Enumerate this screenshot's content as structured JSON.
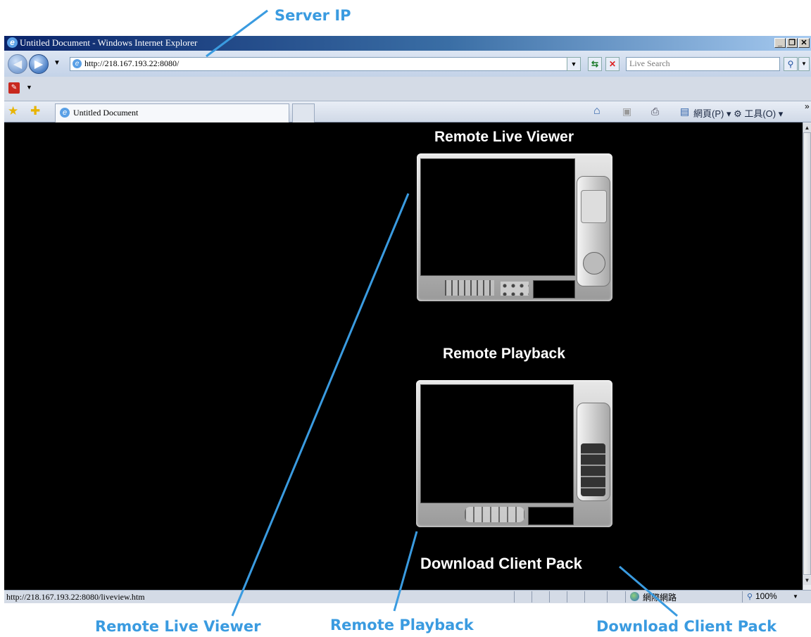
{
  "browser": {
    "window_title": "Untitled Document - Windows Internet Explorer",
    "address": "http://218.167.193.22:8080/",
    "search_placeholder": "Live Search",
    "tab_label": "Untitled Document",
    "toolbar_items": "網頁(P) ▾  ⚙ 工具(O) ▾",
    "status_url": "http://218.167.193.22:8080/liveview.htm",
    "zone": "網際網路",
    "zoom": "100%"
  },
  "page": {
    "live_viewer_title": "Remote Live Viewer",
    "playback_title": "Remote Playback",
    "download_title": "Download Client Pack"
  },
  "callouts": {
    "server_ip": "Server IP",
    "live_viewer": "Remote Live Viewer",
    "playback": "Remote Playback",
    "download": "Download Client Pack"
  },
  "colors": {
    "callout": "#3a9be0",
    "page_bg": "#000000",
    "title_bar": "#0a246a"
  },
  "icons": [
    "ie-logo-icon",
    "back-icon",
    "forward-icon",
    "page-icon",
    "refresh-icon",
    "stop-icon",
    "search-icon",
    "star-icon",
    "add-favorite-icon",
    "home-icon",
    "feeds-icon",
    "print-icon",
    "page-menu-icon",
    "tools-icon",
    "globe-icon",
    "zoom-icon"
  ]
}
